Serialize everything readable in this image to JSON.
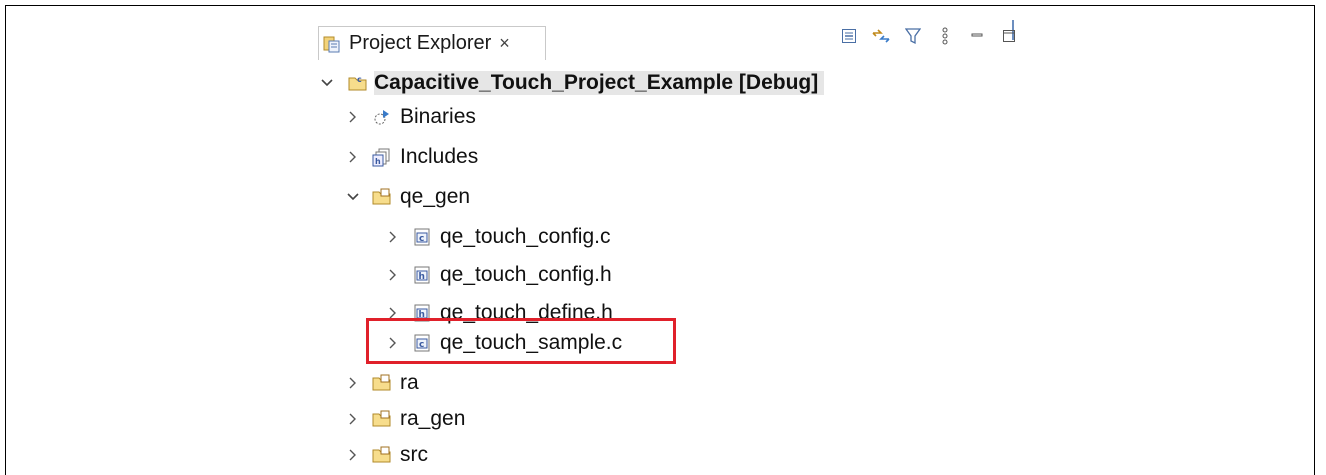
{
  "panel": {
    "tab_title": "Project Explorer",
    "tab_close": "×"
  },
  "toolbar": {
    "icons": [
      "collapse-all-icon",
      "link-with-editor-icon",
      "filter-icon",
      "view-menu-icon",
      "minimize-icon",
      "maximize-icon"
    ]
  },
  "tree": {
    "root": {
      "label": "Capacitive_Touch_Project_Example [Debug]",
      "expanded": true
    },
    "items": [
      {
        "label": "Binaries",
        "icon": "binaries-icon",
        "expanded": false
      },
      {
        "label": "Includes",
        "icon": "includes-icon",
        "expanded": false
      },
      {
        "label": "qe_gen",
        "icon": "source-folder-icon",
        "expanded": true,
        "children": [
          {
            "label": "qe_touch_config.c",
            "icon": "c-file-icon"
          },
          {
            "label": "qe_touch_config.h",
            "icon": "h-file-icon"
          },
          {
            "label": "qe_touch_define.h",
            "icon": "h-file-icon"
          },
          {
            "label": "qe_touch_sample.c",
            "icon": "c-file-icon",
            "highlighted": true
          }
        ]
      },
      {
        "label": "ra",
        "icon": "source-folder-icon",
        "expanded": false
      },
      {
        "label": "ra_gen",
        "icon": "source-folder-icon",
        "expanded": false
      },
      {
        "label": "src",
        "icon": "source-folder-icon",
        "expanded": false
      }
    ]
  },
  "colors": {
    "highlight_box": "#e0202a",
    "root_selection_bg": "#e6e6e6"
  }
}
